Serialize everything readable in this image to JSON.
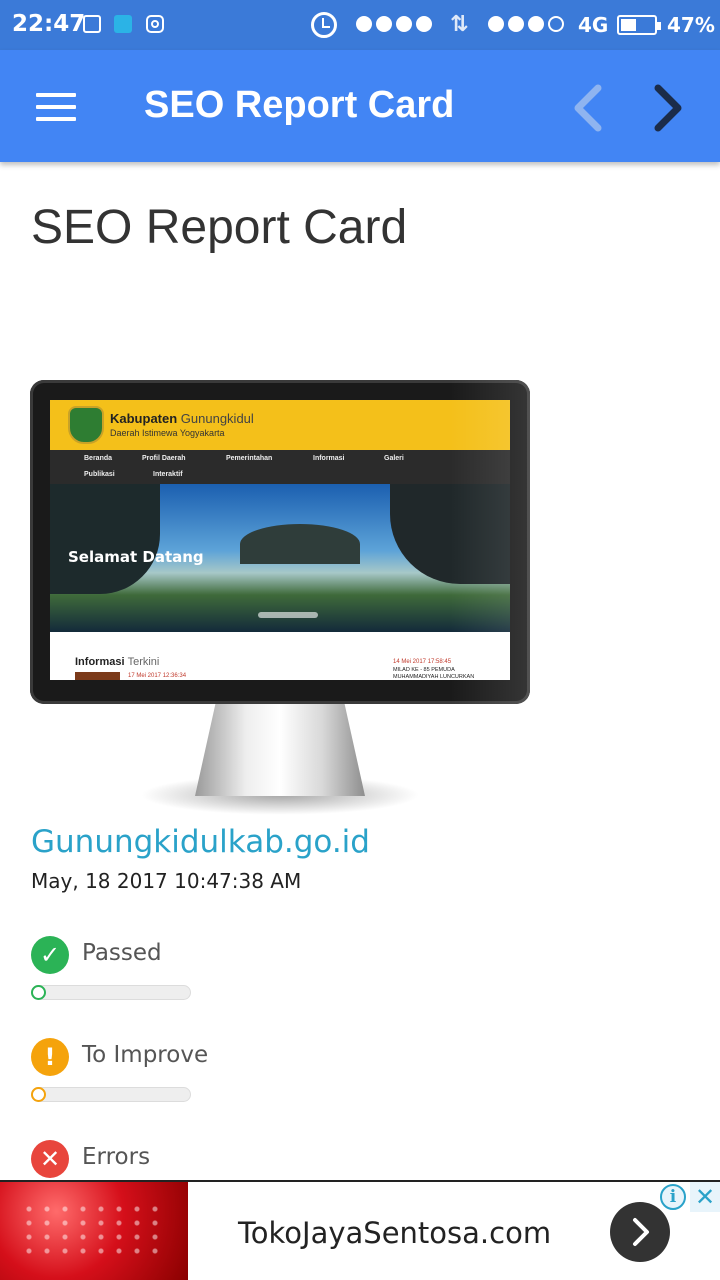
{
  "status_bar": {
    "time": "22:47",
    "network": "4G",
    "battery_percent_text": "47%",
    "battery_level": 0.47,
    "signal_dots_primary": 4,
    "signal_dots_secondary": 3
  },
  "app_bar": {
    "title": "SEO Report Card",
    "menu_icon": "hamburger-menu-icon",
    "back_icon": "chevron-left-icon",
    "forward_icon": "chevron-right-icon"
  },
  "main": {
    "heading": "SEO Report Card",
    "preview": {
      "site_name_bold": "Kabupaten",
      "site_name_light": "Gunungkidul",
      "site_subtitle": "Daerah Istimewa Yogyakarta",
      "nav_items": [
        "Beranda",
        "Profil Daerah",
        "Pemerintahan",
        "Informasi",
        "Galeri",
        "Publikasi",
        "Interaktif"
      ],
      "hero_text": "Selamat Datang",
      "info_bold": "Informasi",
      "info_light": "Terkini",
      "date_left": "17 Mei 2017 12:36:34",
      "date_right": "14 Mei 2017 17:58:45",
      "news_right": "MILAD KE - 85 PEMUDA MUHAMMADIYAH LUNCURKAN"
    },
    "domain": "Gunungkidulkab.go.id",
    "report_date": "May, 18 2017 10:47:38 AM",
    "metrics": [
      {
        "label": "Passed",
        "icon": "check-icon",
        "glyph": "✓",
        "color": "#2bb356",
        "level": 0
      },
      {
        "label": "To Improve",
        "icon": "exclamation-icon",
        "glyph": "!",
        "color": "#f5a30c",
        "level": 0
      },
      {
        "label": "Errors",
        "icon": "cross-icon",
        "glyph": "✕",
        "color": "#e8453c",
        "level": 0
      }
    ]
  },
  "ad": {
    "text": "TokoJayaSentosa.com",
    "info_glyph": "i",
    "close_glyph": "✕"
  }
}
